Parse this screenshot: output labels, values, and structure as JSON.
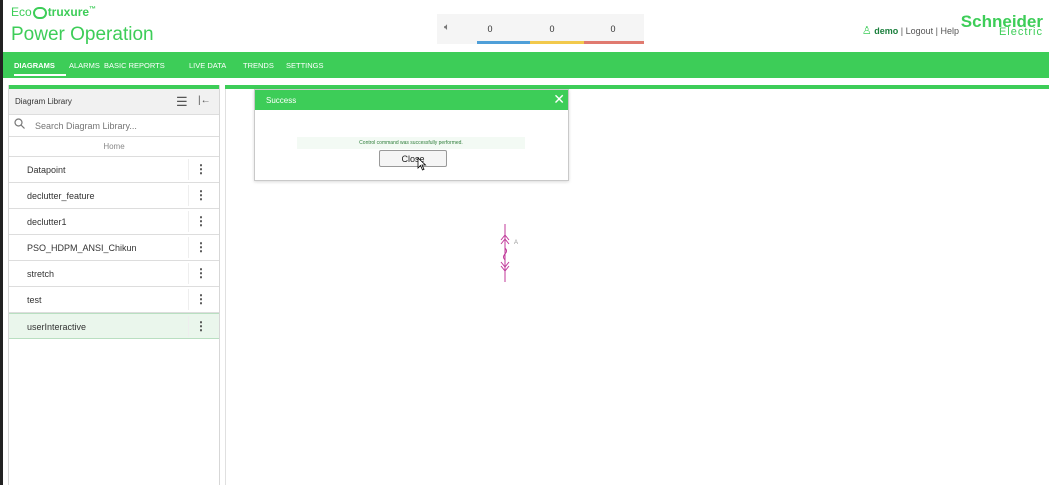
{
  "header": {
    "brand_prefix": "Eco",
    "brand_suffix": "truxure",
    "product_name": "Power Operation",
    "alarm_counts": [
      "0",
      "0",
      "0"
    ],
    "alarm_colors": [
      "#4f9fd8",
      "#f2c94c",
      "#e07a6f"
    ],
    "user_name": "demo",
    "logout_label": "Logout",
    "help_label": "Help",
    "logo_line1": "Schneider",
    "logo_line2": "Electric"
  },
  "nav": {
    "items": [
      {
        "label": "DIAGRAMS",
        "active": true
      },
      {
        "label": "ALARMS"
      },
      {
        "label": "BASIC REPORTS"
      },
      {
        "label": "LIVE DATA"
      },
      {
        "label": "TRENDS"
      },
      {
        "label": "SETTINGS"
      }
    ]
  },
  "sidebar": {
    "title": "Diagram Library",
    "search_placeholder": "Search Diagram Library...",
    "home_label": "Home",
    "items": [
      {
        "label": "Datapoint"
      },
      {
        "label": "declutter_feature"
      },
      {
        "label": "declutter1"
      },
      {
        "label": "PSO_HDPM_ANSI_Chikun"
      },
      {
        "label": "stretch"
      },
      {
        "label": "test"
      },
      {
        "label": "userInteractive",
        "selected": true
      }
    ]
  },
  "dialog": {
    "title": "Success",
    "message": "Control command was successfully performed.",
    "close_button": "Close"
  },
  "diagram": {
    "label": "A"
  },
  "colors": {
    "accent": "#3dcd58",
    "diagram_stroke": "#c0399a"
  }
}
